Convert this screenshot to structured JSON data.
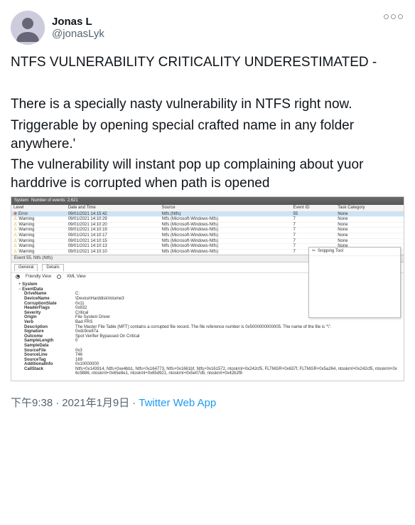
{
  "author": {
    "name": "Jonas L",
    "handle": "@jonasLyk"
  },
  "tweet_lines": [
    "NTFS VULNERABILITY CRITICALITY UNDERESTIMATED -",
    "",
    "There is a specially nasty vulnerability in NTFS right now.",
    "Triggerable by opening special crafted name in any folder anywhere.'",
    "The vulnerability will instant pop up complaining about yuor harddrive is corrupted when path is opened"
  ],
  "sys_header": {
    "label": "System",
    "count_label": "Number of events: 2,621"
  },
  "columns": [
    "Level",
    "Date and Time",
    "Source",
    "Event ID",
    "Task Category"
  ],
  "events": [
    {
      "level": "Error",
      "selected": true,
      "dt": "09/01/2021 14:15:42",
      "src": "Ntfs (Ntfs)",
      "id": "55",
      "task": "None"
    },
    {
      "level": "Warning",
      "dt": "09/01/2021 14:10:29",
      "src": "Ntfs (Microsoft-Windows-Ntfs)",
      "id": "7",
      "task": "None"
    },
    {
      "level": "Warning",
      "dt": "09/01/2021 14:10:20",
      "src": "Ntfs (Microsoft-Windows-Ntfs)",
      "id": "7",
      "task": "None"
    },
    {
      "level": "Warning",
      "dt": "09/01/2021 14:10:19",
      "src": "Ntfs (Microsoft-Windows-Ntfs)",
      "id": "7",
      "task": "None"
    },
    {
      "level": "Warning",
      "dt": "09/01/2021 14:10:17",
      "src": "Ntfs (Microsoft-Windows-Ntfs)",
      "id": "7",
      "task": "None"
    },
    {
      "level": "Warning",
      "dt": "09/01/2021 14:10:15",
      "src": "Ntfs (Microsoft-Windows-Ntfs)",
      "id": "7",
      "task": "None"
    },
    {
      "level": "Warning",
      "dt": "09/01/2021 14:10:13",
      "src": "Ntfs (Microsoft-Windows-Ntfs)",
      "id": "7",
      "task": "None"
    },
    {
      "level": "Warning",
      "dt": "09/01/2021 14:10:10",
      "src": "Ntfs (Microsoft-Windows-Ntfs)",
      "id": "7",
      "task": "None"
    }
  ],
  "details_title": "Event 55, Ntfs (Ntfs)",
  "tabs": {
    "general": "General",
    "details": "Details"
  },
  "view": {
    "friendly": "Friendly View",
    "xml": "XML View"
  },
  "tree": {
    "system": "System",
    "event_data": "EventData"
  },
  "fields": [
    {
      "k": "DriveName",
      "v": "C:"
    },
    {
      "k": "DeviceName",
      "v": "\\Device\\HarddiskVolume3"
    },
    {
      "k": "CorruptionState",
      "v": "0x11"
    },
    {
      "k": "HeaderFlags",
      "v": "0x832"
    },
    {
      "k": "Severity",
      "v": "Critical"
    },
    {
      "k": "Origin",
      "v": "File System Driver"
    },
    {
      "k": "Verb",
      "v": "Bad FRS"
    },
    {
      "k": "Description",
      "v": "The Master File Table (MFT) contains a corrupted file record. The file reference number is 0x5000000000005. The name of the file is \"\\\"."
    },
    {
      "k": "Signature",
      "v": "0xdc9ce87a"
    },
    {
      "k": "Outcome",
      "v": "Spot Verifier Bypassed On Critical"
    },
    {
      "k": "SampleLength",
      "v": "0"
    },
    {
      "k": "SampleData",
      "v": ""
    },
    {
      "k": "SourceFile",
      "v": "0x3"
    },
    {
      "k": "SourceLine",
      "v": "746"
    },
    {
      "k": "SourceTag",
      "v": "169"
    },
    {
      "k": "AdditionalInfo",
      "v": "0x10000000"
    },
    {
      "k": "CallStack",
      "v": "Ntfs+0x143914, Ntfs+0xe4bb1, Ntfs+0x164773, Ntfs+0x1661bf, Ntfs+0x161572, ntoskrnl+0x242cf5, FLTMGR+0x637f, FLTMGR+0x5a264, ntoskrnl+0x242cf5, ntoskrnl+0x6c9886, ntoskrnl+0x65e8e1, ntoskrnl+0x65d921, ntoskrnl+0x5e07d5, ntoskrnl+0x42b2f8"
    }
  ],
  "snip_title": "Snipping Tool",
  "footer": {
    "time": "下午9:38",
    "date": "2021年1月9日",
    "app": "Twitter Web App"
  }
}
